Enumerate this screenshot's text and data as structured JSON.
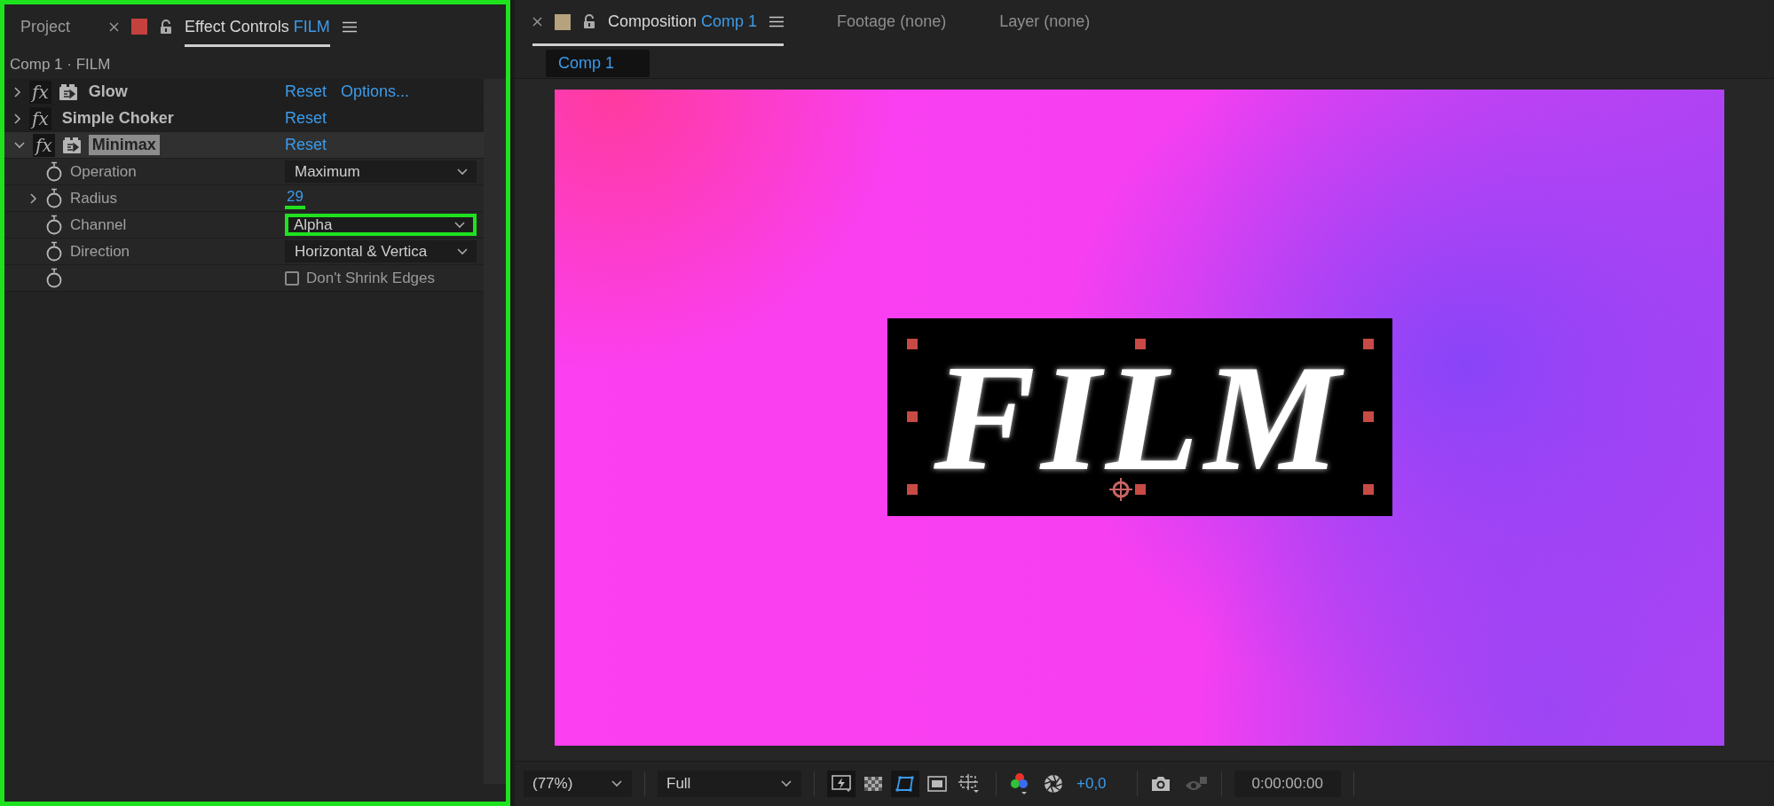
{
  "effect_controls": {
    "highlighted": true,
    "tabs": [
      {
        "label": "Project",
        "selected": false,
        "closable": false
      },
      {
        "label": "Effect Controls",
        "accent": "FILM",
        "selected": true,
        "closable": true,
        "color": "#c4423e"
      }
    ],
    "breadcrumb": "Comp 1 · FILM",
    "effects": [
      {
        "switch": "fx",
        "name": "Glow",
        "expanded": false,
        "selected": false,
        "badge": true,
        "actions": [
          "Reset",
          "Options..."
        ]
      },
      {
        "switch": "fx",
        "name": "Simple Choker",
        "expanded": false,
        "selected": false,
        "badge": false,
        "actions": [
          "Reset"
        ]
      },
      {
        "switch": "fx",
        "name": "Minimax",
        "expanded": true,
        "selected": true,
        "badge": true,
        "actions": [
          "Reset"
        ]
      }
    ],
    "properties": [
      {
        "kind": "dropdown",
        "name": "Operation",
        "value": "Maximum",
        "expandable": false,
        "highlighted": false
      },
      {
        "kind": "number",
        "name": "Radius",
        "value": "29",
        "expandable": true,
        "highlighted": true
      },
      {
        "kind": "dropdown",
        "name": "Channel",
        "value": "Alpha",
        "expandable": false,
        "highlighted": true
      },
      {
        "kind": "dropdown",
        "name": "Direction",
        "value": "Horizontal & Vertica",
        "expandable": false,
        "highlighted": false
      },
      {
        "kind": "checkbox",
        "label": "Don't Shrink Edges",
        "checked": false,
        "expandable": false,
        "highlighted": false
      }
    ]
  },
  "composition": {
    "tabs": [
      {
        "label": "Composition",
        "accent": "Comp 1",
        "selected": true,
        "closable": true,
        "color": "#b5a27e"
      },
      {
        "label": "Footage (none)",
        "selected": false,
        "closable": false
      },
      {
        "label": "Layer (none)",
        "selected": false,
        "closable": false
      }
    ],
    "comp_tab": "Comp 1",
    "canvas_text": "FILM",
    "toolbar": {
      "zoom": "(77%)",
      "resolution": "Full",
      "buttons": [
        {
          "kind": "fast-previews",
          "selected": true
        },
        {
          "kind": "transparency",
          "selected": false
        },
        {
          "kind": "mask",
          "selected": true
        },
        {
          "kind": "region",
          "selected": false
        },
        {
          "kind": "guides",
          "selected": false
        }
      ],
      "exposure": "+0,0",
      "timecode": "0:00:00:00"
    }
  }
}
